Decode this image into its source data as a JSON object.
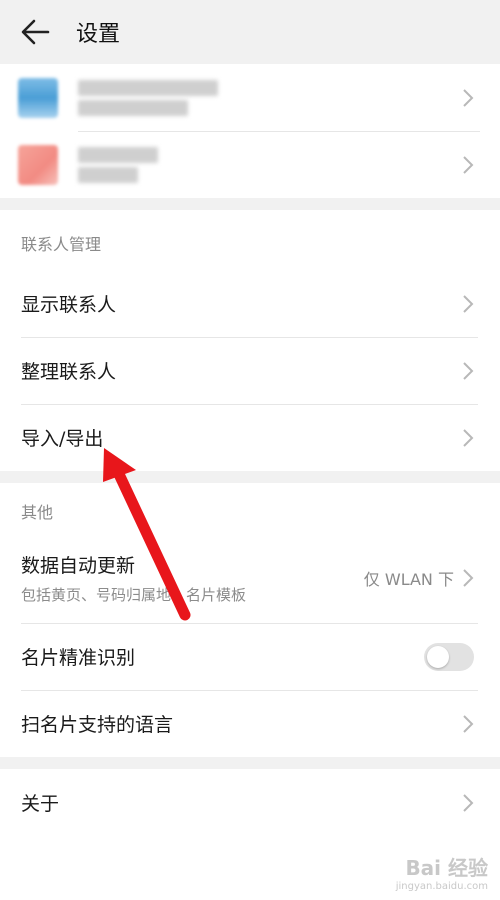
{
  "header": {
    "title": "设置",
    "back_icon": "arrow-left-icon"
  },
  "accounts": [
    {
      "avatar_color": "#4a9ed6"
    },
    {
      "avatar_color": "#f28b83"
    }
  ],
  "contacts_section": {
    "label": "联系人管理",
    "items": [
      {
        "label": "显示联系人"
      },
      {
        "label": "整理联系人"
      },
      {
        "label": "导入/导出"
      }
    ]
  },
  "other_section": {
    "label": "其他",
    "auto_update": {
      "label": "数据自动更新",
      "subtitle": "包括黄页、号码归属地、名片模板",
      "value": "仅 WLAN 下"
    },
    "card_recognition": {
      "label": "名片精准识别",
      "toggle_on": false
    },
    "scan_language": {
      "label": "扫名片支持的语言"
    }
  },
  "about": {
    "label": "关于"
  },
  "annotation": {
    "arrow_color": "#e8161b"
  },
  "watermark": {
    "text": "Bai 经验",
    "sub": "jingyan.baidu.com"
  }
}
